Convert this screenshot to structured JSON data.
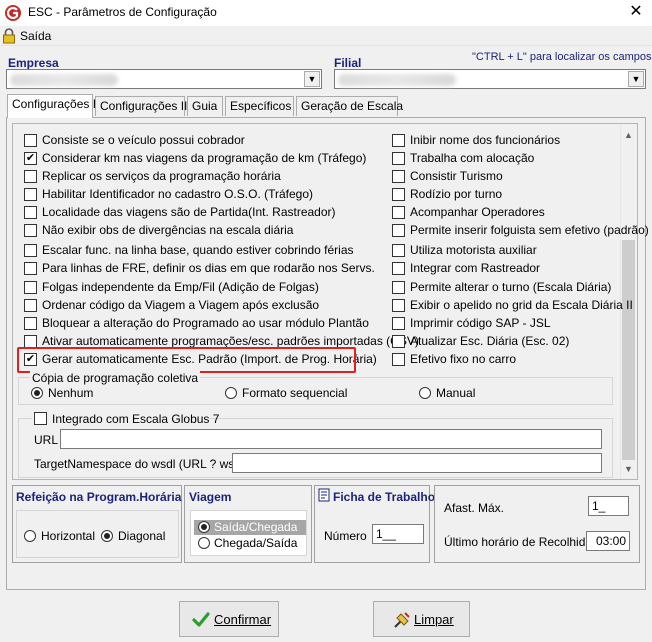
{
  "window": {
    "title": "ESC - Parâmetros de Configuração",
    "close_symbol": "✕"
  },
  "menu": {
    "saida": "Saída"
  },
  "header": {
    "empresa_label": "Empresa",
    "filial_label": "Filial",
    "ctrl_hint": "\"CTRL + L\" para localizar os campos"
  },
  "tabs": [
    {
      "label": "Configurações I",
      "active": true
    },
    {
      "label": "Configurações II"
    },
    {
      "label": "Guia"
    },
    {
      "label": "Específicos"
    },
    {
      "label": "Geração de Escala"
    }
  ],
  "left_options": [
    {
      "label": "Consiste se o veículo possui cobrador",
      "checked": false
    },
    {
      "label": "Considerar km nas viagens da programação de km (Tráfego)",
      "checked": true
    },
    {
      "label": "Replicar os serviços da programação horária",
      "checked": false
    },
    {
      "label": "Habilitar Identificador no cadastro O.S.O. (Tráfego)",
      "checked": false
    },
    {
      "label": "Localidade das viagens são de Partida(Int. Rastreador)",
      "checked": false
    },
    {
      "label": "Não exibir obs de divergências na escala diária",
      "checked": false
    },
    {
      "label": "Escalar func. na linha base, quando estiver cobrindo férias",
      "checked": false
    },
    {
      "label": "Para linhas de FRE, definir os dias em que rodarão nos Servs.",
      "checked": false
    },
    {
      "label": "Folgas independente da Emp/Fil (Adição de Folgas)",
      "checked": false
    },
    {
      "label": "Ordenar código da Viagem a Viagem após exclusão",
      "checked": false
    },
    {
      "label": "Bloquear a alteração do Programado ao usar módulo Plantão",
      "checked": false
    },
    {
      "label": "Ativar automaticamente programações/esc. padrões importadas (CSV)",
      "checked": false
    },
    {
      "label": "Gerar automaticamente Esc. Padrão (Import. de Prog. Horária)",
      "checked": true
    }
  ],
  "right_options": [
    {
      "label": "Inibir nome dos funcionários",
      "checked": false
    },
    {
      "label": "Trabalha com alocação",
      "checked": false
    },
    {
      "label": "Consistir Turismo",
      "checked": false
    },
    {
      "label": "Rodízio por turno",
      "checked": false
    },
    {
      "label": "Acompanhar Operadores",
      "checked": false
    },
    {
      "label": "Permite inserir folguista sem efetivo (padrão)",
      "checked": false
    },
    {
      "label": "Utiliza motorista auxiliar",
      "checked": false
    },
    {
      "label": "Integrar com Rastreador",
      "checked": false
    },
    {
      "label": "Permite alterar o turno (Escala Diária)",
      "checked": false
    },
    {
      "label": "Exibir o apelido no grid da Escala Diária II",
      "checked": false
    },
    {
      "label": "Imprimir código SAP - JSL",
      "checked": false
    },
    {
      "label": "Atualizar Esc. Diária (Esc. 02)",
      "checked": false
    },
    {
      "label": "Efetivo fixo no carro",
      "checked": false
    }
  ],
  "copia": {
    "title": "Cópia de programação coletiva",
    "options": [
      {
        "label": "Nenhum",
        "selected": true
      },
      {
        "label": "Formato sequencial",
        "selected": false
      },
      {
        "label": "Manual",
        "selected": false
      }
    ]
  },
  "globus": {
    "label": "Integrado com Escala Globus 7",
    "checked": false,
    "url_label": "URL",
    "url_value": "",
    "ns_label": "TargetNamespace do wsdl (URL ? wsdl)",
    "ns_value": ""
  },
  "refeicao": {
    "title": "Refeição na Program.Horária",
    "options": [
      {
        "label": "Horizontal",
        "selected": false
      },
      {
        "label": "Diagonal",
        "selected": true
      }
    ]
  },
  "viagem": {
    "title": "Viagem",
    "options": [
      {
        "label": "Saída/Chegada",
        "selected": true
      },
      {
        "label": "Chegada/Saída",
        "selected": false
      }
    ]
  },
  "ficha": {
    "title": "Ficha de Trabalho",
    "numero_label": "Número",
    "numero_value": "1__"
  },
  "afast": {
    "max_label": "Afast. Máx.",
    "max_value": "1_",
    "ultimo_label": "Último horário de Recolhida",
    "ultimo_value": "03:00"
  },
  "buttons": {
    "confirmar": "Confirmar",
    "limpar": "Limpar"
  }
}
